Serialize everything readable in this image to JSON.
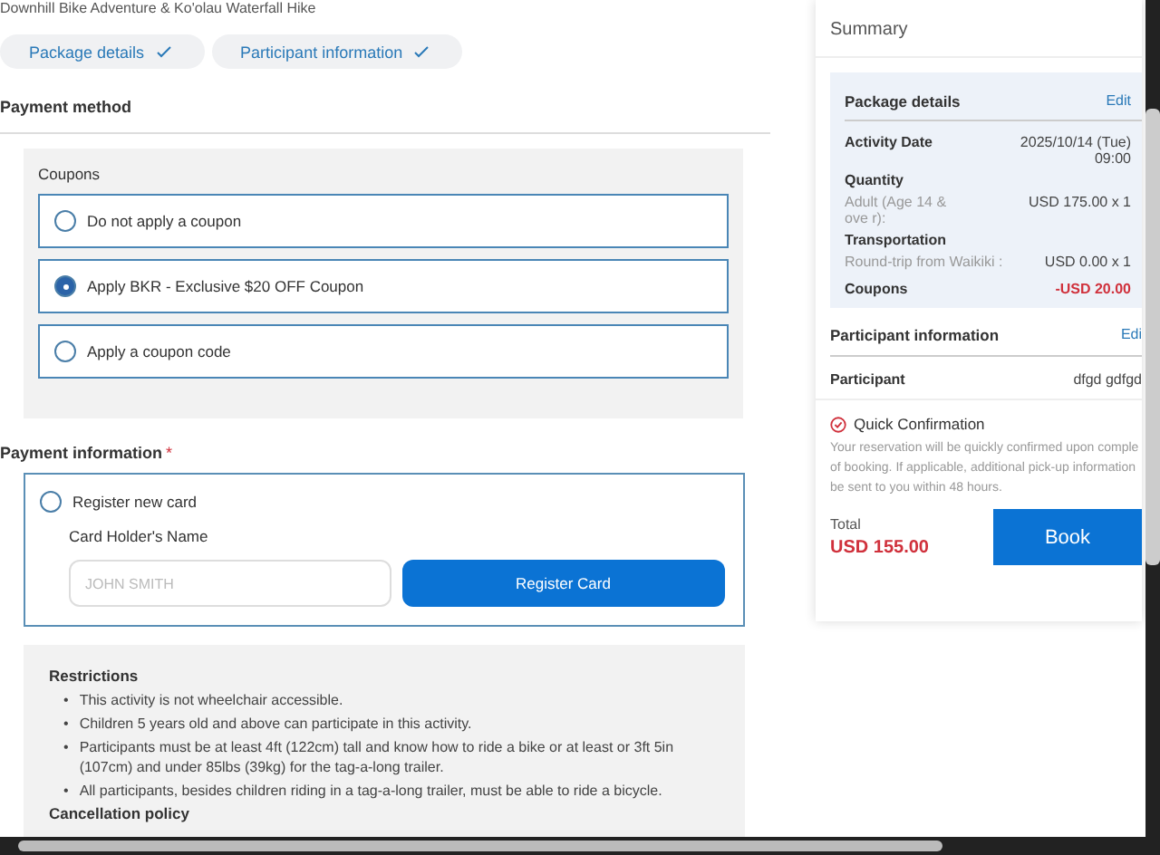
{
  "page_title": "Downhill Bike Adventure & Ko'olau Waterfall Hike",
  "steps": [
    {
      "label": "Package details",
      "done": true
    },
    {
      "label": "Participant information",
      "done": true
    }
  ],
  "payment_method": {
    "title": "Payment method",
    "coupons": {
      "title": "Coupons",
      "options": [
        {
          "label": "Do not apply a coupon",
          "selected": false
        },
        {
          "label": "Apply BKR - Exclusive $20 OFF Coupon",
          "selected": true
        },
        {
          "label": "Apply a coupon code",
          "selected": false
        }
      ]
    }
  },
  "payment_information": {
    "title": "Payment information",
    "required_mark": "*",
    "option": {
      "label": "Register new card",
      "selected": false
    },
    "card_holder_label": "Card Holder's Name",
    "card_holder_placeholder": "JOHN SMITH",
    "register_button": "Register Card"
  },
  "restrictions": {
    "title": "Restrictions",
    "marker": "•",
    "items": [
      "This activity is not wheelchair accessible.",
      "Children 5 years old and above can participate in this activity.",
      "Participants must be at least 4ft (122cm) tall and know how to ride a bike or at least or 3ft 5in (107cm) and under 85lbs (39kg) for the tag-a-long trailer.",
      "All participants, besides children riding in a tag-a-long trailer, must be able to ride a bicycle."
    ],
    "next_title": "Cancellation policy"
  },
  "summary": {
    "title": "Summary",
    "package": {
      "title": "Package details",
      "edit": "Edit",
      "activity_date_label": "Activity Date",
      "activity_date": "2025/10/14 (Tue) 09:00",
      "quantity_label": "Quantity",
      "quantity_item": "Adult (Age 14 & ove r):",
      "quantity_price": "USD 175.00 x 1",
      "transport_label": "Transportation",
      "transport_item": "Round-trip from Waikiki :",
      "transport_price": "USD 0.00 x 1",
      "coupons_label": "Coupons",
      "coupons_value": "-USD 20.00"
    },
    "participant": {
      "title": "Participant information",
      "edit": "Edi",
      "label": "Participant",
      "value": "dfgd gdfgd"
    },
    "quick_confirmation": {
      "title": "Quick Confirmation",
      "lines": [
        "Your reservation will be quickly confirmed upon comple",
        "of booking. If applicable, additional pick-up information",
        "be sent to you within 48 hours."
      ]
    },
    "total_label": "Total",
    "total": "USD 155.00",
    "book_button": "Book"
  }
}
